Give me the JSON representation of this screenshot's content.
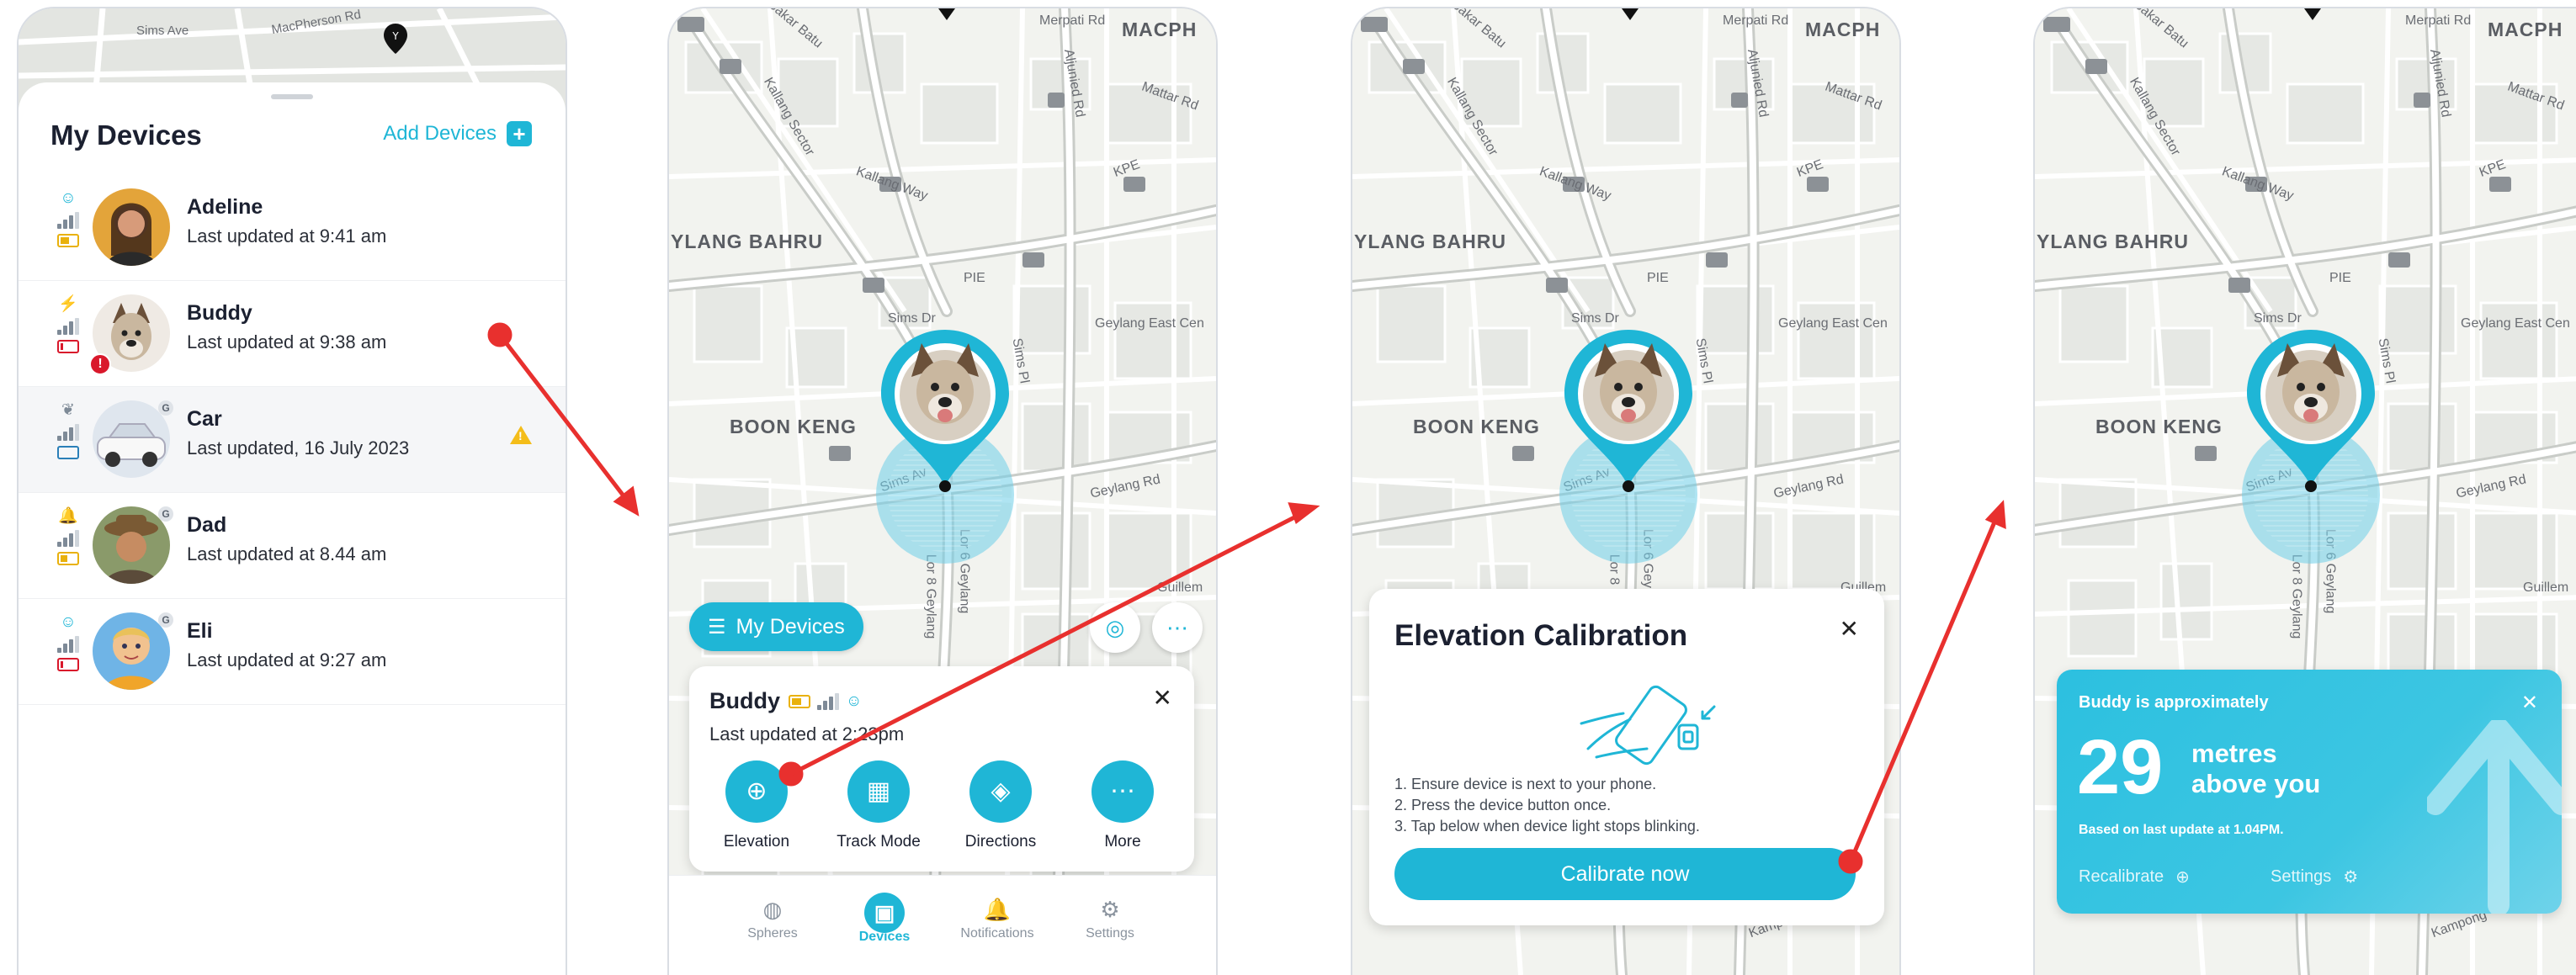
{
  "screen1": {
    "map_labels": [
      "Sims Ave",
      "MacPherson Rd"
    ],
    "title": "My Devices",
    "add_label": "Add Devices",
    "devices": [
      {
        "name": "Adeline",
        "updated": "Last updated at 9:41 am",
        "status_icon": "smiley-icon",
        "battery": 0.6,
        "battery_color": "#e9b10c",
        "avatar": "woman-portrait"
      },
      {
        "name": "Buddy",
        "updated": "Last updated at 9:38 am",
        "status_icon": "lightning-icon",
        "battery": 0.2,
        "battery_color": "#d9182b",
        "avatar": "dog-portrait",
        "alert": "!"
      },
      {
        "name": "Car",
        "updated": "Last updated, 16 July 2023",
        "status_icon": "leaf-icon",
        "battery": 0.0,
        "battery_color": "#2a7fb8",
        "avatar": "car-photo",
        "badge": "G",
        "warning": true
      },
      {
        "name": "Dad",
        "updated": "Last updated at 8.44 am",
        "status_icon": "bell-icon",
        "battery": 0.5,
        "battery_color": "#e9b10c",
        "avatar": "man-portrait",
        "badge": "G"
      },
      {
        "name": "Eli",
        "updated": "Last updated at 9:27 am",
        "status_icon": "smiley-icon",
        "battery": 0.2,
        "battery_color": "#d9182b",
        "avatar": "child-portrait",
        "badge": "G"
      }
    ]
  },
  "map": {
    "labels": {
      "macph": "MACPH",
      "ylang_bahru": "YLANG BAHRU",
      "boon_keng": "BOON KENG",
      "sims_ave": "Sims Av",
      "geylang_rd": "Geylang Rd",
      "pie": "PIE",
      "kpe": "KPE",
      "aljunied": "Aljunied Rd",
      "kallang_way": "Kallang Way",
      "bakar_batu": "Bakar Batu",
      "merpati": "Merpati Rd",
      "sims_dr": "Sims Dr",
      "sims_pl": "Sims Pl",
      "geylang_east": "Geylang East Cen",
      "mattar": "Mattar Rd",
      "lor8": "Lor 8 Geylang",
      "lor6": "Lor 6 Geylang",
      "kallang_sector": "Kallang Sector",
      "guillem": "Guillem",
      "kampong": "Kampong"
    }
  },
  "screen2": {
    "my_devices_label": "My Devices",
    "more_dots": "⋯",
    "card": {
      "name": "Buddy",
      "updated": "Last updated at 2:23pm",
      "actions": [
        {
          "label": "Elevation",
          "icon": "crosshair-icon"
        },
        {
          "label": "Track Mode",
          "icon": "grid-icon"
        },
        {
          "label": "Directions",
          "icon": "directions-icon"
        },
        {
          "label": "More",
          "icon": "more-icon"
        }
      ]
    },
    "tabs": [
      {
        "label": "Spheres",
        "icon": "globe-icon"
      },
      {
        "label": "Devices",
        "icon": "device-icon",
        "active": true
      },
      {
        "label": "Notifications",
        "icon": "bell-icon"
      },
      {
        "label": "Settings",
        "icon": "gear-icon"
      }
    ]
  },
  "screen3": {
    "title": "Elevation Calibration",
    "steps": [
      "1. Ensure device is next to your phone.",
      "2. Press the device button once.",
      "3. Tap below when device light stops blinking."
    ],
    "button": "Calibrate now"
  },
  "screen4": {
    "heading": "Buddy is approximately",
    "value": "29",
    "unit_line1": "metres",
    "unit_line2": "above you",
    "based_on": "Based on last update at 1.04PM.",
    "recalibrate": "Recalibrate",
    "settings": "Settings",
    "direction": "up"
  },
  "colors": {
    "accent": "#1fb6d6",
    "arrow": "#e8302e",
    "alert": "#d9182b",
    "warning": "#f4bd1a"
  }
}
